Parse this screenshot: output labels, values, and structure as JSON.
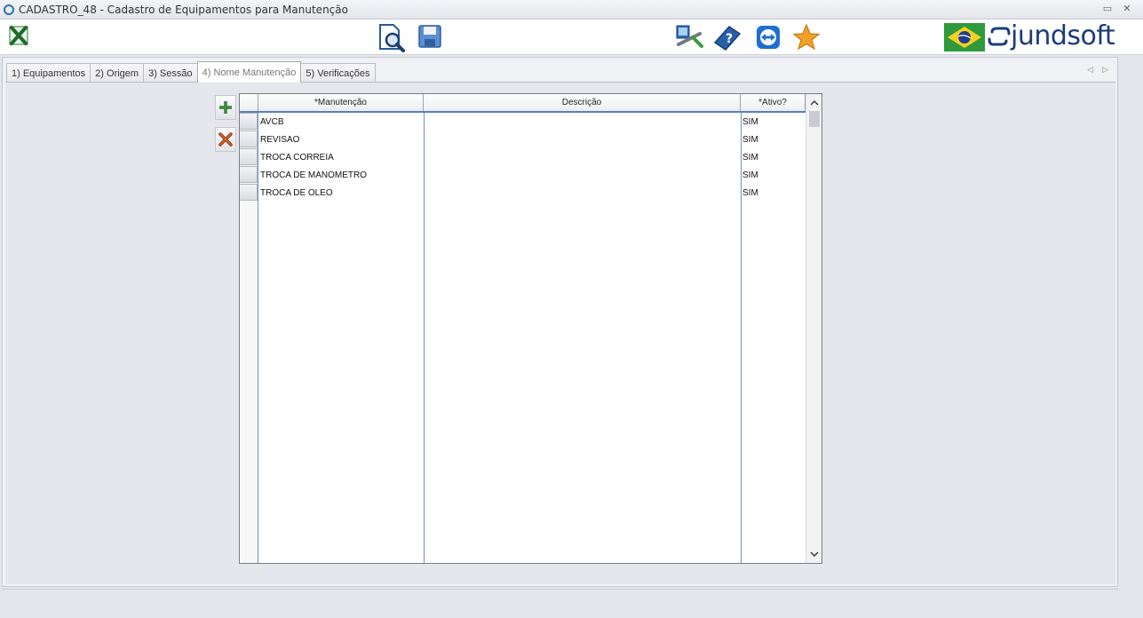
{
  "window": {
    "title": "CADASTRO_48 - Cadastro de Equipamentos para Manutenção"
  },
  "toolbar": {
    "icons": [
      "excel-icon",
      "search-document-icon",
      "save-icon",
      "remote-support-icon",
      "help-book-icon",
      "teamviewer-icon",
      "favorite-star-icon"
    ],
    "brand": "jundsoft",
    "flag": "brazil-flag-icon"
  },
  "tabs": [
    {
      "label": "1) Equipamentos",
      "active": false
    },
    {
      "label": "2) Origem",
      "active": false
    },
    {
      "label": "3) Sessão",
      "active": false
    },
    {
      "label": "4) Nome Manutenção",
      "active": true
    },
    {
      "label": "5) Verificações",
      "active": false
    }
  ],
  "side_buttons": {
    "add": "add-icon",
    "delete": "delete-icon"
  },
  "grid": {
    "columns": [
      "*Manutenção",
      "Descrição",
      "*Ativo?"
    ],
    "rows": [
      {
        "manutencao": "AVCB",
        "descricao": "",
        "ativo": "SIM"
      },
      {
        "manutencao": "REVISAO",
        "descricao": "",
        "ativo": "SIM"
      },
      {
        "manutencao": "TROCA CORREIA",
        "descricao": "",
        "ativo": "SIM"
      },
      {
        "manutencao": "TROCA DE MANOMETRO",
        "descricao": "",
        "ativo": "SIM"
      },
      {
        "manutencao": "TROCA DE OLEO",
        "descricao": "",
        "ativo": "SIM"
      }
    ]
  },
  "colors": {
    "header_underline": "#5a7fb8",
    "brand_blue": "#1b3c78",
    "accent_green": "#2e7d32",
    "delete_orange": "#c9541a"
  }
}
